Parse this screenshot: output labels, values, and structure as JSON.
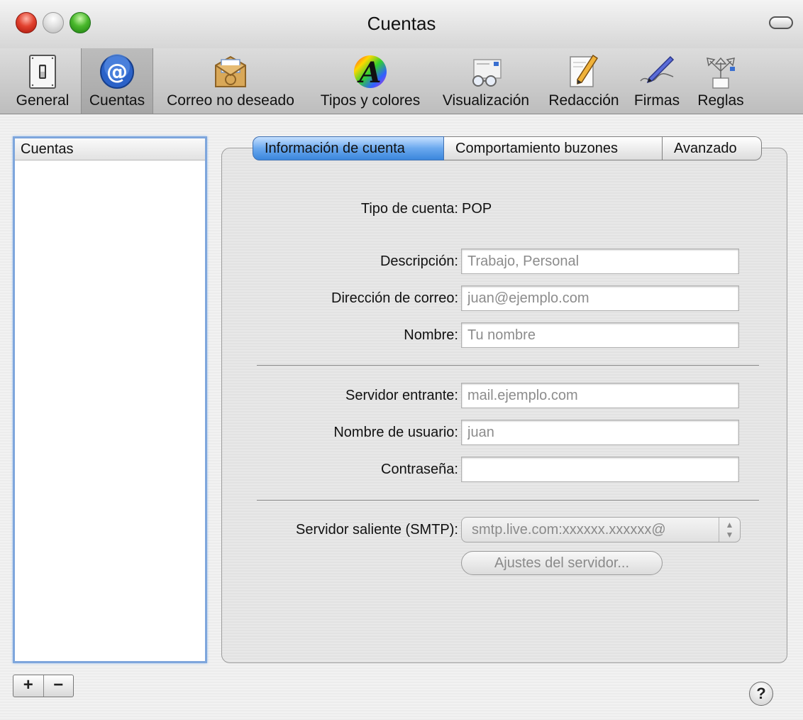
{
  "window": {
    "title": "Cuentas"
  },
  "toolbar": {
    "items": [
      {
        "label": "General",
        "icon": "switch-icon"
      },
      {
        "label": "Cuentas",
        "icon": "at-icon"
      },
      {
        "label": "Correo no deseado",
        "icon": "junk-mail-icon"
      },
      {
        "label": "Tipos y colores",
        "icon": "fonts-colors-icon"
      },
      {
        "label": "Visualización",
        "icon": "viewing-glasses-icon"
      },
      {
        "label": "Redacción",
        "icon": "composing-pencil-icon"
      },
      {
        "label": "Firmas",
        "icon": "signature-pen-icon"
      },
      {
        "label": "Reglas",
        "icon": "rules-arrows-icon"
      }
    ],
    "selected": "Cuentas"
  },
  "sidebar": {
    "header": "Cuentas",
    "add_label": "+",
    "remove_label": "−"
  },
  "tabs": [
    {
      "label": "Información de cuenta",
      "selected": true
    },
    {
      "label": "Comportamiento buzones",
      "selected": false
    },
    {
      "label": "Avanzado",
      "selected": false
    }
  ],
  "form": {
    "account_type_label": "Tipo de cuenta:",
    "account_type_value": "POP",
    "description_label": "Descripción:",
    "description_placeholder": "Trabajo, Personal",
    "email_label": "Dirección de correo:",
    "email_placeholder": "juan@ejemplo.com",
    "name_label": "Nombre:",
    "name_placeholder": "Tu nombre",
    "incoming_label": "Servidor entrante:",
    "incoming_placeholder": "mail.ejemplo.com",
    "username_label": "Nombre de usuario:",
    "username_placeholder": "juan",
    "password_label": "Contraseña:",
    "smtp_label": "Servidor saliente (SMTP):",
    "smtp_value": "smtp.live.com:xxxxxx.xxxxxx@",
    "server_settings_button": "Ajustes del servidor..."
  },
  "help_label": "?"
}
